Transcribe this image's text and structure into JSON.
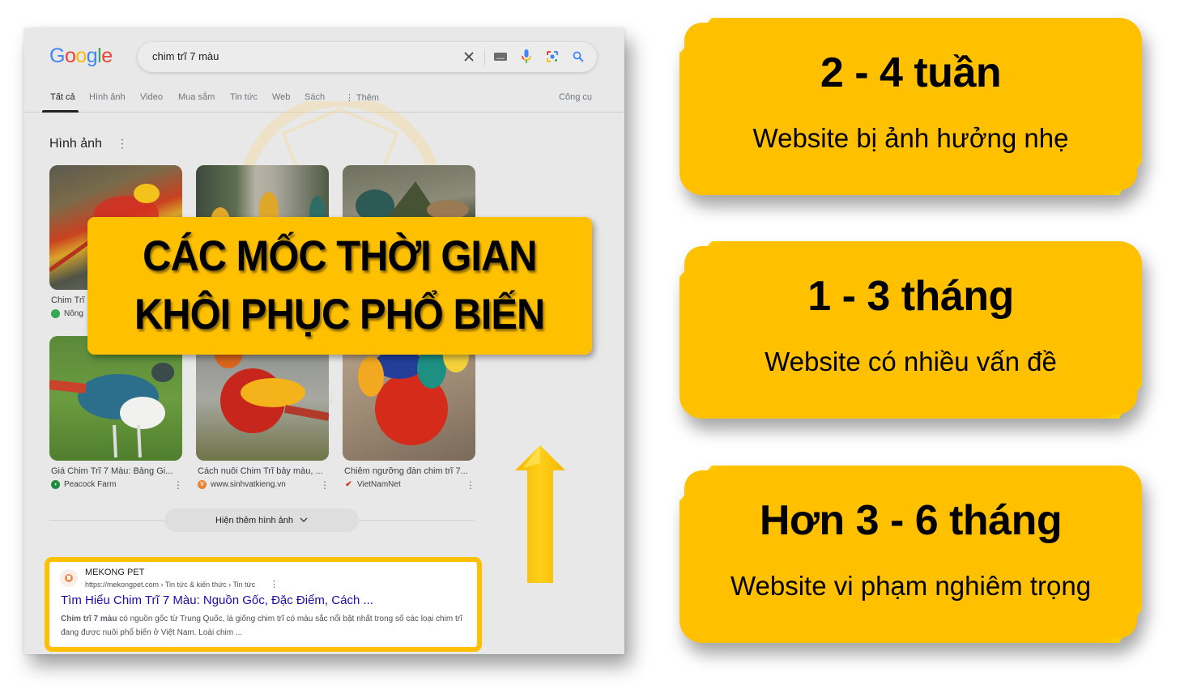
{
  "google": {
    "logo_letters": [
      {
        "ch": "G",
        "color": "#4285f4"
      },
      {
        "ch": "o",
        "color": "#ea4335"
      },
      {
        "ch": "o",
        "color": "#fbbc05"
      },
      {
        "ch": "g",
        "color": "#4285f4"
      },
      {
        "ch": "l",
        "color": "#34a853"
      },
      {
        "ch": "e",
        "color": "#ea4335"
      }
    ],
    "search_query": "chim trĩ 7 màu",
    "search_icons": [
      "clear-icon",
      "keyboard-icon",
      "microphone-icon",
      "google-lens-icon",
      "search-icon"
    ],
    "tabs": [
      {
        "label": "Tất cả",
        "active": true
      },
      {
        "label": "Hình ảnh"
      },
      {
        "label": "Video"
      },
      {
        "label": "Mua sắm"
      },
      {
        "label": "Tin tức"
      },
      {
        "label": "Web"
      },
      {
        "label": "Sách"
      },
      {
        "label": "⋮ Thêm"
      }
    ],
    "tools_label": "Công cụ",
    "images_heading": "Hình ảnh",
    "images_more": "⋮",
    "image_results": [
      {
        "caption": "Chim Trĩ",
        "source": "Nông",
        "source_icon_color": "#34a853"
      },
      {
        "caption": "",
        "source": ""
      },
      {
        "caption": "",
        "source": ""
      },
      {
        "caption": "Giá Chim Trĩ 7 Màu: Bảng Gi...",
        "source": "Peacock Farm",
        "source_icon_color": "#1e8e3e"
      },
      {
        "caption": "Cách nuôi Chim Trĩ bảy màu, ...",
        "source": "www.sinhvatkieng.vn",
        "source_icon_color": "#e8833a",
        "source_icon_letter": "V"
      },
      {
        "caption": "Chiêm ngưỡng đàn chim trĩ 7...",
        "source": "VietNamNet",
        "source_icon_color": "#d93025"
      }
    ],
    "show_more_images": "Hiện thêm hình ảnh",
    "result": {
      "site_name": "MEKONG PET",
      "url": "https://mekongpet.com › Tin tức & kiến thức › Tin tức",
      "title": "Tìm Hiểu Chim Trĩ 7 Màu: Nguồn Gốc, Đặc Điểm, Cách ...",
      "snippet_bold": "Chim trĩ 7 màu",
      "snippet_rest": " có nguồn gốc từ Trung Quốc, là giống chim trĩ có màu sắc nổi bật nhất trong số các loại chim trĩ đang được nuôi phổ biến ở Việt Nam. Loài chim ..."
    }
  },
  "banner": {
    "line1": "CÁC MỐC THỜI GIAN",
    "line2": "KHÔI PHỤC PHỔ BIẾN"
  },
  "timeline": [
    {
      "title": "2 - 4 tuần",
      "subtitle": "Website bị ảnh hưởng nhẹ"
    },
    {
      "title": "1 - 3 tháng",
      "subtitle": "Website có nhiều vấn đề"
    },
    {
      "title": "Hơn 3 - 6 tháng",
      "subtitle": "Website vi phạm nghiêm trọng"
    }
  ],
  "colors": {
    "accent": "#ffc000",
    "bevel_highlight": "#ffff00",
    "link": "#1a0dab"
  }
}
